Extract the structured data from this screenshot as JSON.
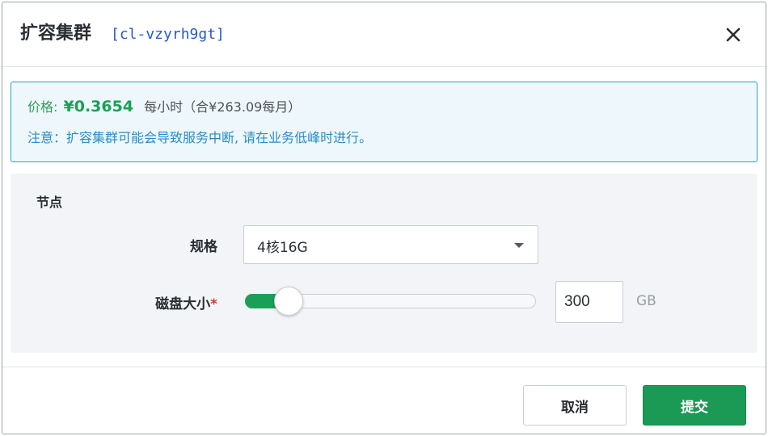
{
  "dialog": {
    "title": "扩容集群",
    "cluster_id": "[cl-vzyrh9gt]",
    "close_icon": "close-icon"
  },
  "notice": {
    "price_label": "价格:",
    "price_value": "¥0.3654",
    "price_unit": "每小时（合¥263.09每月）",
    "warning": "注意：扩容集群可能会导致服务中断, 请在业务低峰时进行。",
    "colors": {
      "price": "#19a056",
      "warning": "#2a8cc5",
      "border": "#2a9fd0"
    }
  },
  "node": {
    "section_title": "节点",
    "spec_label": "规格",
    "spec_value": "4核16G",
    "disk_label": "磁盘大小",
    "required_mark": "*",
    "disk_value": "300",
    "disk_unit": "GB",
    "slider_fill_fraction": 0.14
  },
  "footer": {
    "cancel_label": "取消",
    "submit_label": "提交",
    "submit_color": "#1b9a55"
  }
}
